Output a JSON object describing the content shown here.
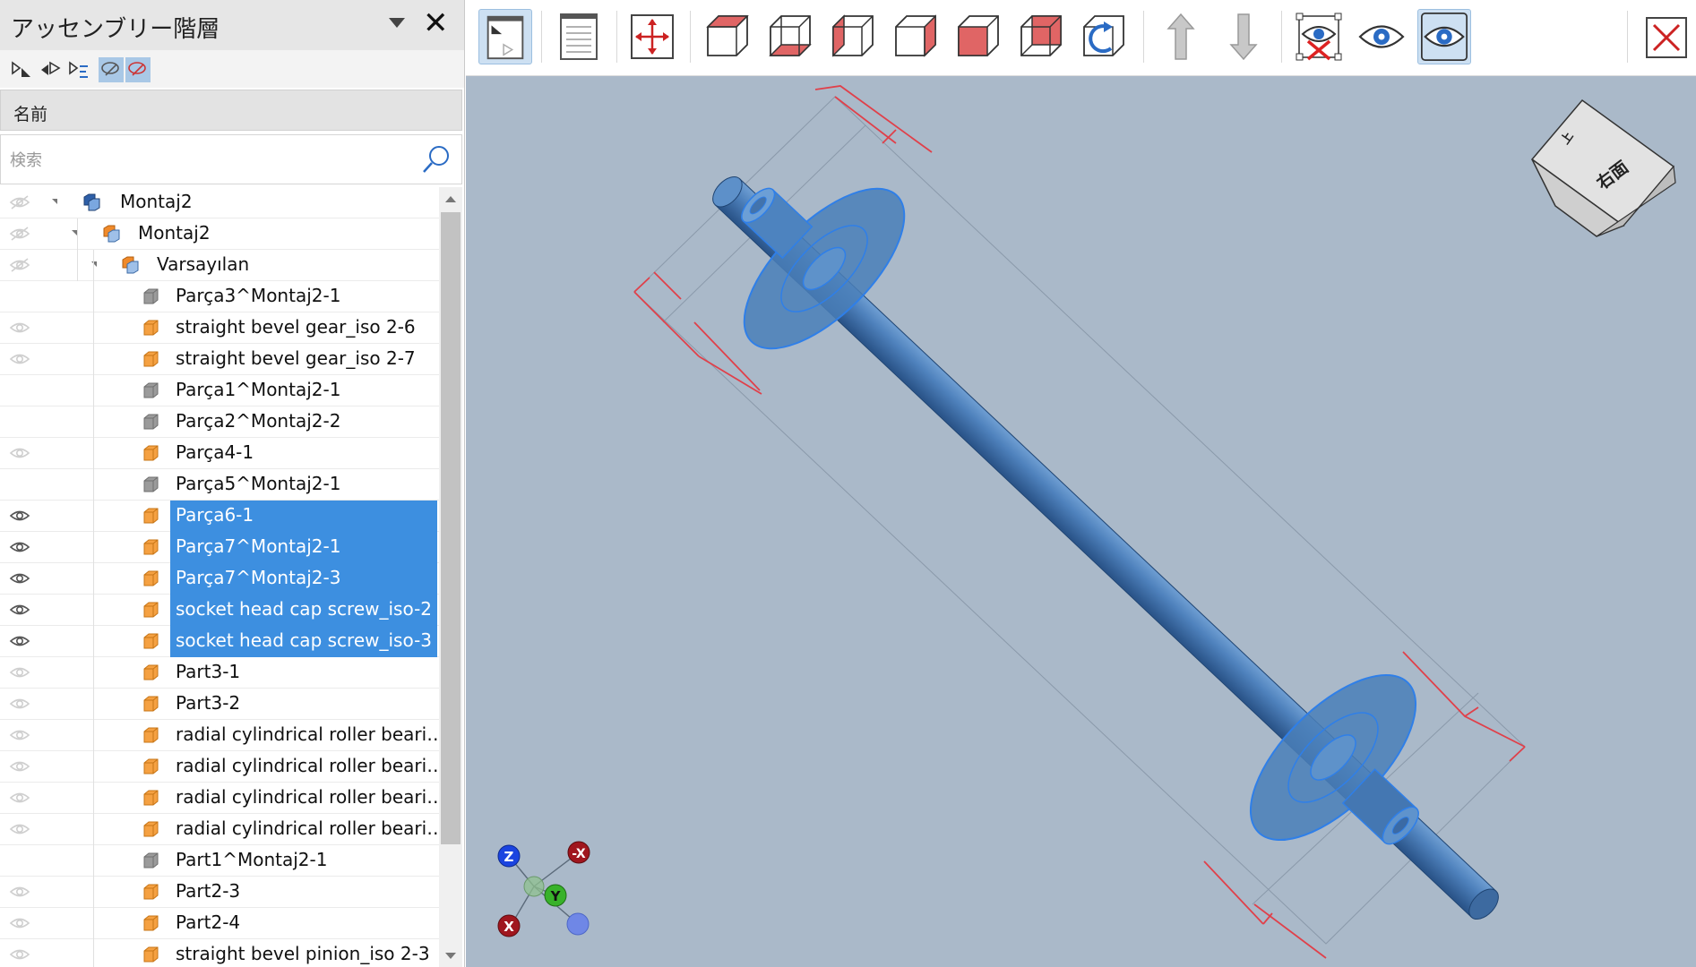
{
  "panel": {
    "title": "アッセンブリー階層",
    "column_header": "名前",
    "search_placeholder": "検索",
    "close_glyph": "✕"
  },
  "tree": {
    "rows": [
      {
        "label": "Montaj2",
        "level": 0,
        "icon": "assembly-icon",
        "eye": "hidden",
        "expanded": true,
        "selected": false
      },
      {
        "label": "Montaj2",
        "level": 1,
        "icon": "subassembly-icon",
        "eye": "hidden",
        "expanded": true,
        "selected": false
      },
      {
        "label": "Varsayılan",
        "level": 2,
        "icon": "config-icon",
        "eye": "hidden",
        "expanded": true,
        "selected": false
      },
      {
        "label": "Parça3^Montaj2-1",
        "level": 3,
        "icon": "part-gray-icon",
        "eye": "none",
        "selected": false
      },
      {
        "label": "straight bevel gear_iso 2-6",
        "level": 3,
        "icon": "part-orange-icon",
        "eye": "faint",
        "selected": false
      },
      {
        "label": "straight bevel gear_iso 2-7",
        "level": 3,
        "icon": "part-orange-icon",
        "eye": "faint",
        "selected": false
      },
      {
        "label": "Parça1^Montaj2-1",
        "level": 3,
        "icon": "part-gray-icon",
        "eye": "none",
        "selected": false
      },
      {
        "label": "Parça2^Montaj2-2",
        "level": 3,
        "icon": "part-gray-icon",
        "eye": "none",
        "selected": false
      },
      {
        "label": "Parça4-1",
        "level": 3,
        "icon": "part-orange-icon",
        "eye": "faint",
        "selected": false
      },
      {
        "label": "Parça5^Montaj2-1",
        "level": 3,
        "icon": "part-gray-icon",
        "eye": "none",
        "selected": false
      },
      {
        "label": "Parça6-1",
        "level": 3,
        "icon": "part-orange-icon",
        "eye": "visible",
        "selected": true
      },
      {
        "label": "Parça7^Montaj2-1",
        "level": 3,
        "icon": "part-orange-icon",
        "eye": "visible",
        "selected": true
      },
      {
        "label": "Parça7^Montaj2-3",
        "level": 3,
        "icon": "part-orange-icon",
        "eye": "visible",
        "selected": true
      },
      {
        "label": "socket head cap screw_iso-2",
        "level": 3,
        "icon": "part-orange-icon",
        "eye": "visible",
        "selected": true
      },
      {
        "label": "socket head cap screw_iso-3",
        "level": 3,
        "icon": "part-orange-icon",
        "eye": "visible",
        "selected": true
      },
      {
        "label": "Part3-1",
        "level": 3,
        "icon": "part-orange-icon",
        "eye": "faint",
        "selected": false
      },
      {
        "label": "Part3-2",
        "level": 3,
        "icon": "part-orange-icon",
        "eye": "faint",
        "selected": false
      },
      {
        "label": "radial cylindrical roller beari…",
        "level": 3,
        "icon": "part-orange-icon",
        "eye": "faint",
        "selected": false
      },
      {
        "label": "radial cylindrical roller beari…",
        "level": 3,
        "icon": "part-orange-icon",
        "eye": "faint",
        "selected": false
      },
      {
        "label": "radial cylindrical roller beari…",
        "level": 3,
        "icon": "part-orange-icon",
        "eye": "faint",
        "selected": false
      },
      {
        "label": "radial cylindrical roller beari…",
        "level": 3,
        "icon": "part-orange-icon",
        "eye": "faint",
        "selected": false
      },
      {
        "label": "Part1^Montaj2-1",
        "level": 3,
        "icon": "part-gray-icon",
        "eye": "none",
        "selected": false
      },
      {
        "label": "Part2-3",
        "level": 3,
        "icon": "part-orange-icon",
        "eye": "faint",
        "selected": false
      },
      {
        "label": "Part2-4",
        "level": 3,
        "icon": "part-orange-icon",
        "eye": "faint",
        "selected": false
      },
      {
        "label": "straight bevel pinion_iso 2-3",
        "level": 3,
        "icon": "part-orange-icon",
        "eye": "faint",
        "selected": false
      }
    ]
  },
  "toolbar": {
    "buttons": [
      "panel-toggle-icon",
      "document-icon",
      "fit-view-icon",
      "view-front-icon",
      "view-bottom-icon",
      "view-left-icon",
      "view-right-icon",
      "view-back-icon",
      "view-top-icon",
      "rotate-view-icon",
      "move-up-icon",
      "move-down-icon",
      "hide-selected-icon",
      "show-icon",
      "show-all-icon",
      "close-icon"
    ]
  },
  "viewcube": {
    "face_label": "右面",
    "top_label": "上"
  },
  "triad": {
    "z": "Z",
    "y": "Y",
    "x": "X",
    "neg_x": "-X"
  },
  "colors": {
    "selection": "#3d8fe0",
    "viewport": "#aab9c9",
    "part_blue": "#4a7fb8",
    "dim_red": "#e0404a"
  }
}
